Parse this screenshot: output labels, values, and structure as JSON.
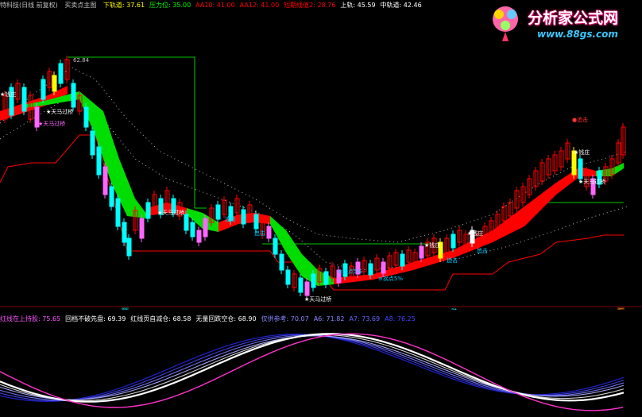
{
  "header": {
    "title": "特科技(日线 前复权)",
    "formula": "买卖点主图",
    "indicators": [
      {
        "label": "下轨道",
        "value": "37.61",
        "color": "#ffff00"
      },
      {
        "label": "压力位",
        "value": "35.00",
        "color": "#00ff00"
      },
      {
        "label": "AA10",
        "value": "41.00",
        "color": "#ff0000"
      },
      {
        "label": "AA12",
        "value": "41.00",
        "color": "#ff0000"
      },
      {
        "label": "短期线值2",
        "value": "28.76",
        "color": "#ff0000"
      },
      {
        "label": "上轨",
        "value": "45.59",
        "color": "#ffffff"
      },
      {
        "label": "中轨道",
        "value": "42.46",
        "color": "#ffffff"
      }
    ]
  },
  "chart": {
    "high_label": "62.84",
    "annotations": [
      {
        "text": "★天马过桥",
        "color": "#ffffff"
      },
      {
        "text": "★天马过桥",
        "color": "#ff66ff"
      },
      {
        "text": "★天马过桥",
        "color": "#ffffff"
      },
      {
        "text": "★天马过桥",
        "color": "#ffffff"
      },
      {
        "text": "追击",
        "color": "#00ccff"
      },
      {
        "text": "追击",
        "color": "#00ccff"
      },
      {
        "text": "追击",
        "color": "#00ccff"
      },
      {
        "text": "追击",
        "color": "#00ccff"
      },
      {
        "text": "≡拐点5%",
        "color": "#00ccff"
      },
      {
        "text": "≡拐点5%",
        "color": "#00ccff"
      },
      {
        "text": "★天马过桥",
        "color": "#ffffff"
      },
      {
        "text": "★钱庄",
        "color": "#ffffff"
      },
      {
        "text": "★钱庄",
        "color": "#ffffff"
      },
      {
        "text": "★钱庄",
        "color": "#ffffff"
      },
      {
        "text": "★钱庄",
        "color": "#ffffff"
      },
      {
        "text": "●追击",
        "color": "#ff3333"
      }
    ],
    "markers": [
      "除",
      "财",
      "医"
    ]
  },
  "sub_header": {
    "indicators": [
      {
        "label": "红线在上持股",
        "value": "75.65",
        "color": "#ff55ff"
      },
      {
        "label": "回档不破先盘",
        "value": "69.39",
        "color": "#ffffff"
      },
      {
        "label": "红线页自减仓",
        "value": "68.58",
        "color": "#ffffff"
      },
      {
        "label": "无量回跌空仓",
        "value": "68.90",
        "color": "#ffffff"
      },
      {
        "label": "仅供参考",
        "value": "70.07",
        "color": "#8888ff"
      },
      {
        "label": "A6",
        "value": "71.82",
        "color": "#8888ff"
      },
      {
        "label": "A7",
        "value": "73.69",
        "color": "#6666ff"
      },
      {
        "label": "A8",
        "value": "76.25",
        "color": "#4444ff"
      }
    ]
  },
  "logo": {
    "title": "分析家公式网",
    "url": "www.88gs.com"
  }
}
